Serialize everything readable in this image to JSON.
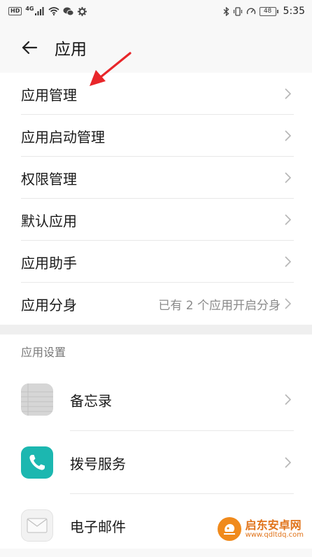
{
  "status_bar": {
    "left_badge": "HD",
    "network": "4G",
    "battery": "48",
    "time": "5:35"
  },
  "header": {
    "back_icon": "arrow-left-icon",
    "title": "应用"
  },
  "menu": {
    "items": [
      {
        "label": "应用管理",
        "value": ""
      },
      {
        "label": "应用启动管理",
        "value": ""
      },
      {
        "label": "权限管理",
        "value": ""
      },
      {
        "label": "默认应用",
        "value": ""
      },
      {
        "label": "应用助手",
        "value": ""
      },
      {
        "label": "应用分身",
        "value": "已有 2 个应用开启分身"
      }
    ]
  },
  "app_settings": {
    "header": "应用设置",
    "items": [
      {
        "label": "备忘录",
        "icon": "memo-icon"
      },
      {
        "label": "拨号服务",
        "icon": "phone-icon"
      },
      {
        "label": "电子邮件",
        "icon": "mail-icon"
      }
    ]
  },
  "annotation": {
    "color": "#e8262a",
    "target": "应用管理"
  },
  "watermark": {
    "name": "启东安卓网",
    "url": "www.qdltdq.com"
  },
  "colors": {
    "accent_teal": "#1cb7b0",
    "background": "#f8f8f8",
    "watermark_orange": "#f08a1c"
  }
}
